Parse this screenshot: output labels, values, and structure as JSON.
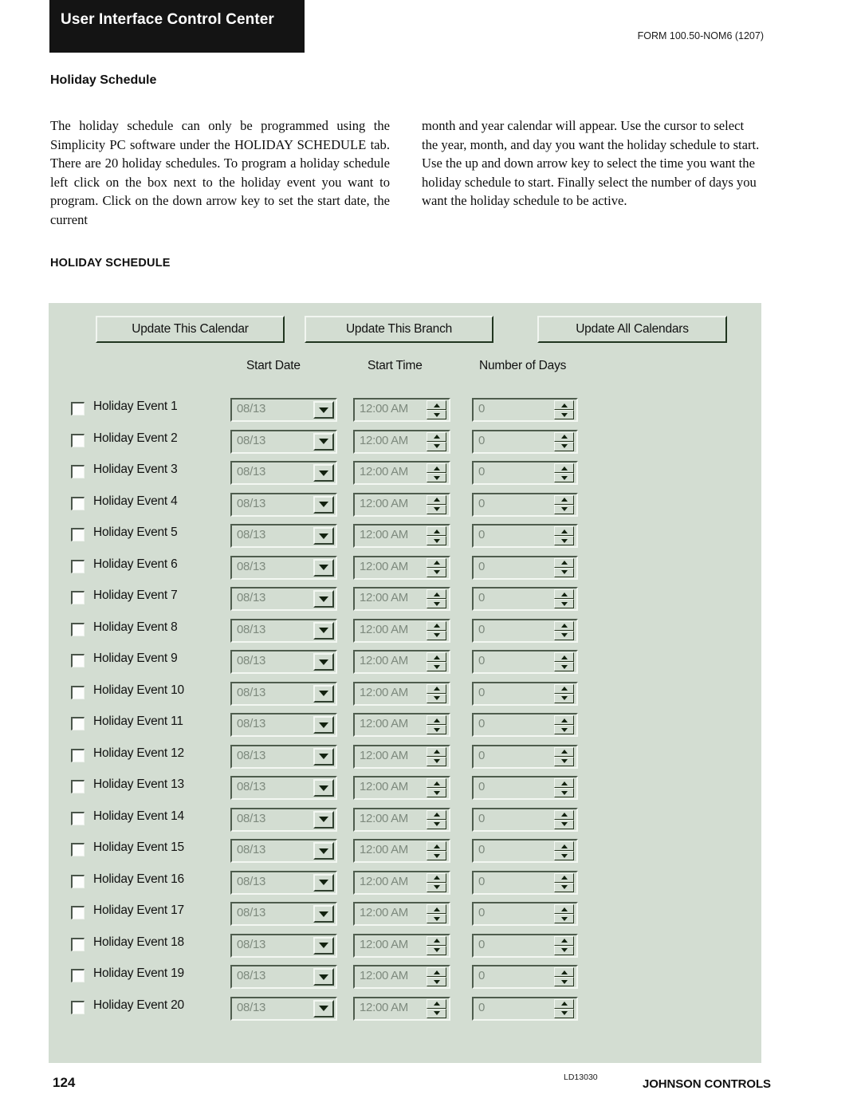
{
  "header": {
    "brand_title": "User Interface Control Center",
    "form_code": "FORM 100.50-NOM6 (1207)"
  },
  "section": {
    "title": "Holiday Schedule",
    "body_left": "The holiday schedule can only be programmed using the Simplicity PC software under the HOLIDAY SCHEDULE tab. There are 20 holiday schedules. To program a holiday schedule left click on the box next to the holiday event you want to program. Click on the down arrow key to set the start date, the current",
    "body_right": "month and year calendar will appear. Use the cursor to select the year, month, and day you want the holiday schedule to start. Use the up and down arrow key to select the time you want the holiday schedule to start. Finally select the number of days you want the holiday schedule to be active."
  },
  "screenshot_caption": "HOLIDAY SCHEDULE",
  "app": {
    "buttons": [
      {
        "label": "Update This Calendar"
      },
      {
        "label": "Update This Branch"
      },
      {
        "label": "Update All Calendars"
      }
    ],
    "column_headers": {
      "start_date": "Start Date",
      "start_time": "Start Time",
      "number_of_days": "Number of Days"
    },
    "default_values": {
      "start_date": "08/13",
      "start_time": "12:00 AM",
      "number_of_days": "0"
    },
    "colors": {
      "panel_background": "#d3ddd2",
      "field_text": "#7e8a7e",
      "header_bar": "#141414"
    },
    "rows": [
      {
        "label": "Holiday Event 1",
        "checked": false,
        "start_date": "08/13",
        "start_time": "12:00 AM",
        "number_of_days": "0"
      },
      {
        "label": "Holiday Event 2",
        "checked": false,
        "start_date": "08/13",
        "start_time": "12:00 AM",
        "number_of_days": "0"
      },
      {
        "label": "Holiday Event 3",
        "checked": false,
        "start_date": "08/13",
        "start_time": "12:00 AM",
        "number_of_days": "0"
      },
      {
        "label": "Holiday Event 4",
        "checked": false,
        "start_date": "08/13",
        "start_time": "12:00 AM",
        "number_of_days": "0"
      },
      {
        "label": "Holiday Event 5",
        "checked": false,
        "start_date": "08/13",
        "start_time": "12:00 AM",
        "number_of_days": "0"
      },
      {
        "label": "Holiday Event 6",
        "checked": false,
        "start_date": "08/13",
        "start_time": "12:00 AM",
        "number_of_days": "0"
      },
      {
        "label": "Holiday Event 7",
        "checked": false,
        "start_date": "08/13",
        "start_time": "12:00 AM",
        "number_of_days": "0"
      },
      {
        "label": "Holiday Event 8",
        "checked": false,
        "start_date": "08/13",
        "start_time": "12:00 AM",
        "number_of_days": "0"
      },
      {
        "label": "Holiday Event 9",
        "checked": false,
        "start_date": "08/13",
        "start_time": "12:00 AM",
        "number_of_days": "0"
      },
      {
        "label": "Holiday Event 10",
        "checked": false,
        "start_date": "08/13",
        "start_time": "12:00 AM",
        "number_of_days": "0"
      },
      {
        "label": "Holiday Event 11",
        "checked": false,
        "start_date": "08/13",
        "start_time": "12:00 AM",
        "number_of_days": "0"
      },
      {
        "label": "Holiday Event 12",
        "checked": false,
        "start_date": "08/13",
        "start_time": "12:00 AM",
        "number_of_days": "0"
      },
      {
        "label": "Holiday Event 13",
        "checked": false,
        "start_date": "08/13",
        "start_time": "12:00 AM",
        "number_of_days": "0"
      },
      {
        "label": "Holiday Event 14",
        "checked": false,
        "start_date": "08/13",
        "start_time": "12:00 AM",
        "number_of_days": "0"
      },
      {
        "label": "Holiday Event 15",
        "checked": false,
        "start_date": "08/13",
        "start_time": "12:00 AM",
        "number_of_days": "0"
      },
      {
        "label": "Holiday Event 16",
        "checked": false,
        "start_date": "08/13",
        "start_time": "12:00 AM",
        "number_of_days": "0"
      },
      {
        "label": "Holiday Event 17",
        "checked": false,
        "start_date": "08/13",
        "start_time": "12:00 AM",
        "number_of_days": "0"
      },
      {
        "label": "Holiday Event 18",
        "checked": false,
        "start_date": "08/13",
        "start_time": "12:00 AM",
        "number_of_days": "0"
      },
      {
        "label": "Holiday Event 19",
        "checked": false,
        "start_date": "08/13",
        "start_time": "12:00 AM",
        "number_of_days": "0"
      },
      {
        "label": "Holiday Event 20",
        "checked": false,
        "start_date": "08/13",
        "start_time": "12:00 AM",
        "number_of_days": "0"
      }
    ]
  },
  "footer": {
    "page_number": "124",
    "doc_code": "LD13030",
    "company": "JOHNSON CONTROLS"
  }
}
